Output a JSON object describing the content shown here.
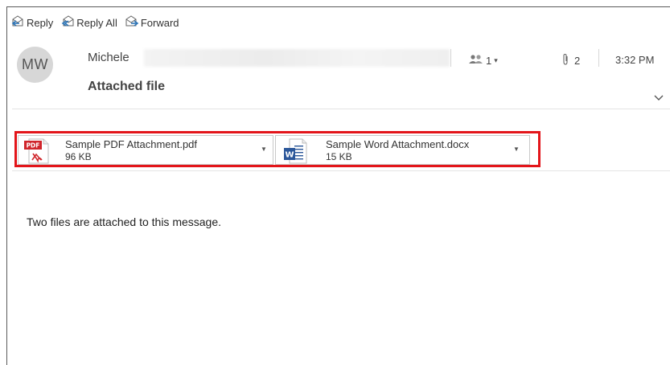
{
  "toolbar": {
    "reply_label": "Reply",
    "reply_all_label": "Reply All",
    "forward_label": "Forward"
  },
  "message": {
    "sender_initials": "MW",
    "sender_name": "Michele",
    "subject": "Attached file",
    "people_count": "1",
    "attachment_count": "2",
    "time": "3:32 PM",
    "body": "Two files are attached to this message."
  },
  "attachments": [
    {
      "name": "Sample PDF Attachment.pdf",
      "size": "96 KB",
      "type": "pdf",
      "icon_badge": "PDF"
    },
    {
      "name": "Sample Word Attachment.docx",
      "size": "15 KB",
      "type": "word",
      "icon_badge": "W"
    }
  ],
  "colors": {
    "highlight": "#e3151a",
    "pdf_red": "#d0252b",
    "word_blue": "#2b579a",
    "reply_icon_blue": "#2e75b6"
  }
}
